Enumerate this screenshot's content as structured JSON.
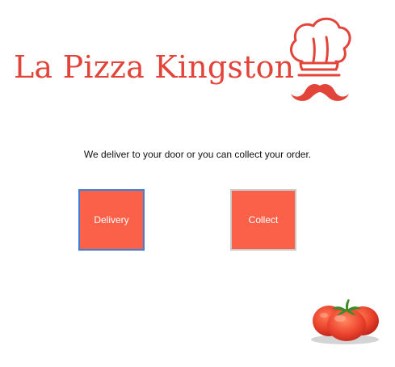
{
  "header": {
    "brand_name": "La Pizza Kingston"
  },
  "main": {
    "tagline": "We deliver to your door or you can collect your order.",
    "options": {
      "delivery_label": "Delivery",
      "collect_label": "Collect"
    }
  },
  "icons": {
    "logo": "chef-hat-mustache-icon",
    "decoration": "tomato-icon"
  },
  "colors": {
    "brand_red": "#e2443a",
    "button_fill": "#fb6149",
    "focus_outline": "#3d7fd6",
    "button_border": "#c9c9c9"
  }
}
